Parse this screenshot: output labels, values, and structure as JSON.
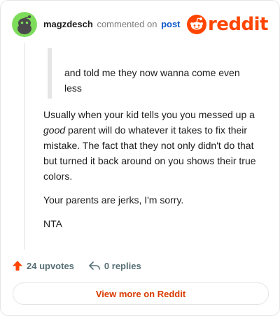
{
  "header": {
    "author": "magzdesch",
    "action": "commented on",
    "post_link": "post",
    "logo_text": "reddit"
  },
  "quote": {
    "text": "and told me they now wanna come even less"
  },
  "comment": {
    "para1_before": "Usually when your kid tells you you messed up a ",
    "para1_emphasis": "good",
    "para1_after": " parent will do whatever it takes to fix their mistake. The fact that they not only didn't do that but turned it back around on you shows their true colors.",
    "para2": "Your parents are jerks, I'm sorry.",
    "para3": "NTA"
  },
  "actions": {
    "upvotes": "24 upvotes",
    "replies": "0 replies",
    "view_more": "View more on Reddit"
  },
  "colors": {
    "brand": "#ff4500",
    "avatar_bg": "#7ddc5a",
    "link": "#0a58ca"
  },
  "icons": {
    "avatar": "snoo-avatar-icon",
    "logo": "reddit-logo-icon",
    "upvote": "upvote-arrow-icon",
    "reply": "reply-arrow-icon"
  }
}
